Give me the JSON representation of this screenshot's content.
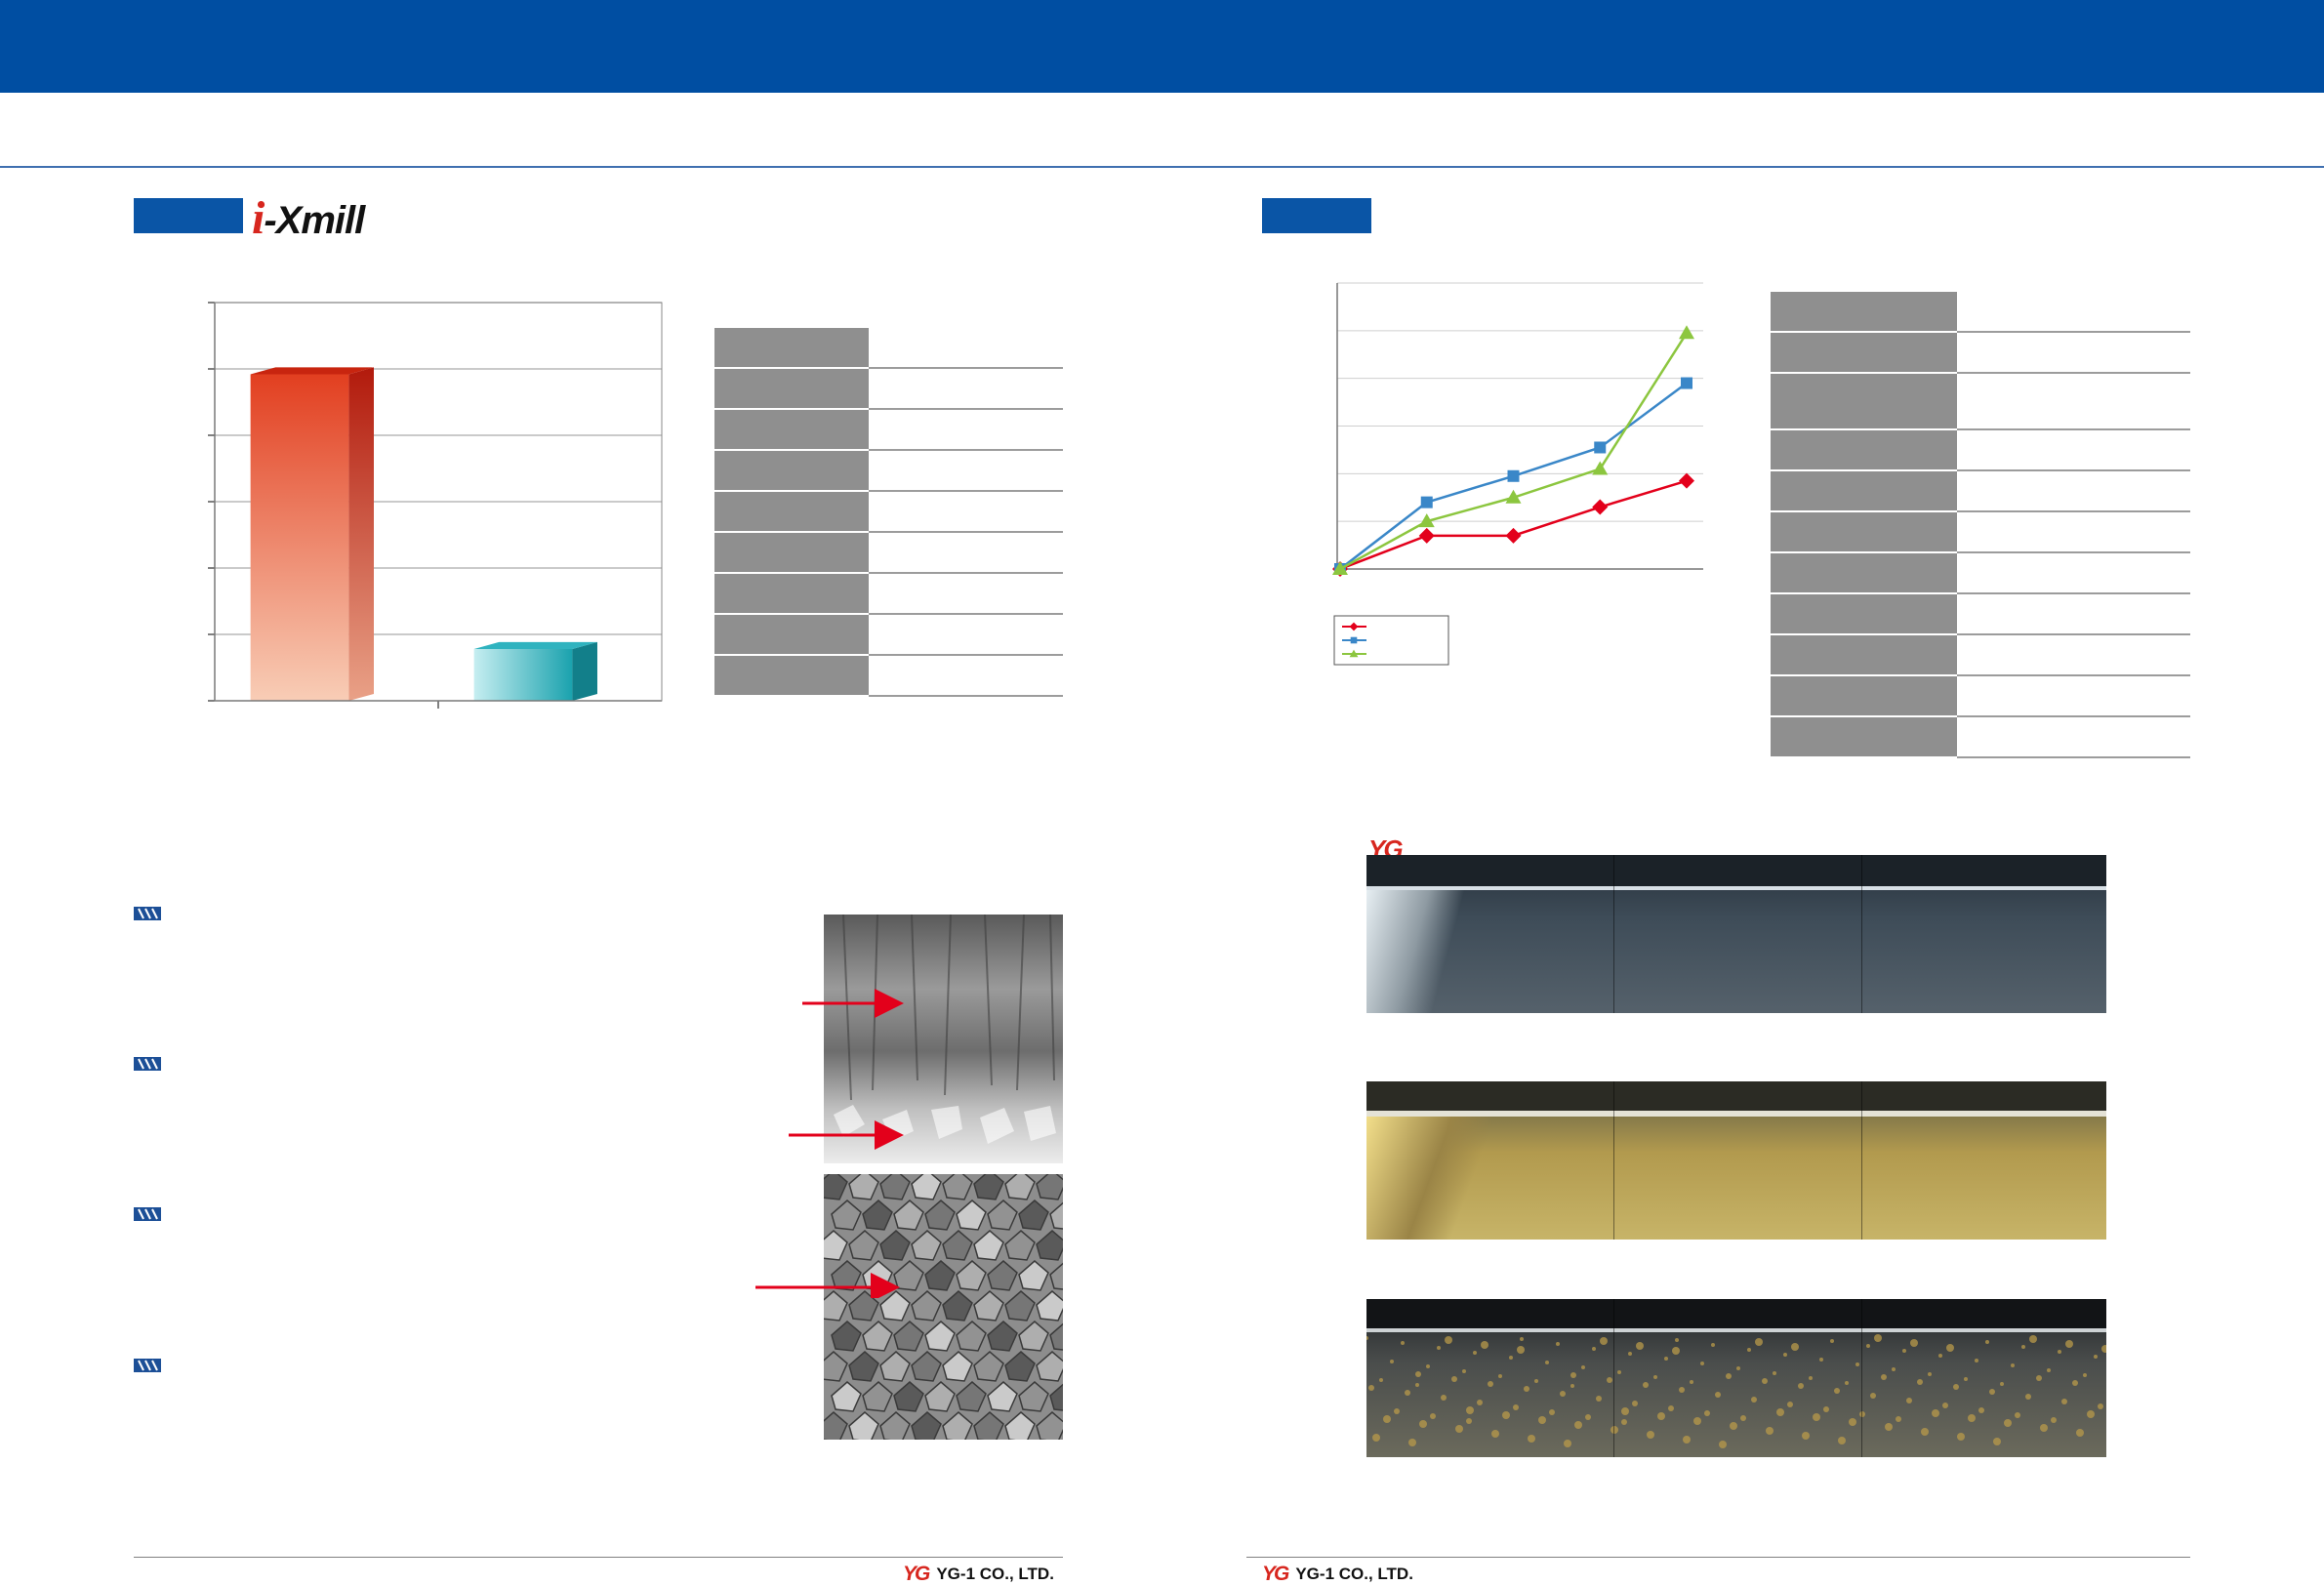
{
  "brand": {
    "logo_prefix": "i",
    "logo_suffix": "-Xmill"
  },
  "colors": {
    "header_blue": "#004ea2",
    "bar_red": "#e04a2b",
    "bar_teal": "#1e9aa8",
    "series_red": "#e3001b",
    "series_blue": "#3a87c8",
    "series_green": "#8cc63f"
  },
  "chart_data": [
    {
      "type": "bar",
      "categories": [
        "",
        ""
      ],
      "values": [
        0.82,
        0.13
      ],
      "ylim": [
        0,
        1
      ],
      "yticks": 6,
      "grid": true,
      "title": "",
      "xlabel": "",
      "ylabel": ""
    },
    {
      "type": "line",
      "x": [
        0,
        1,
        2,
        3,
        4
      ],
      "series": [
        {
          "values": [
            0,
            0.7,
            0.7,
            1.3,
            1.85
          ],
          "color": "#e3001b",
          "marker": "diamond"
        },
        {
          "values": [
            0,
            1.4,
            1.95,
            2.55,
            3.9
          ],
          "color": "#3a87c8",
          "marker": "square"
        },
        {
          "values": [
            0,
            1.0,
            1.5,
            2.1,
            4.95
          ],
          "color": "#8cc63f",
          "marker": "triangle"
        }
      ],
      "ylim": [
        0,
        6
      ],
      "grid": true,
      "legend": "bottom-left",
      "title": "",
      "xlabel": "",
      "ylabel": ""
    }
  ],
  "left_table_rows": 9,
  "right_table_rows": 11,
  "photo_brand": "YG",
  "footer": {
    "logo_mark": "YG",
    "company": "YG-1 CO., LTD."
  }
}
